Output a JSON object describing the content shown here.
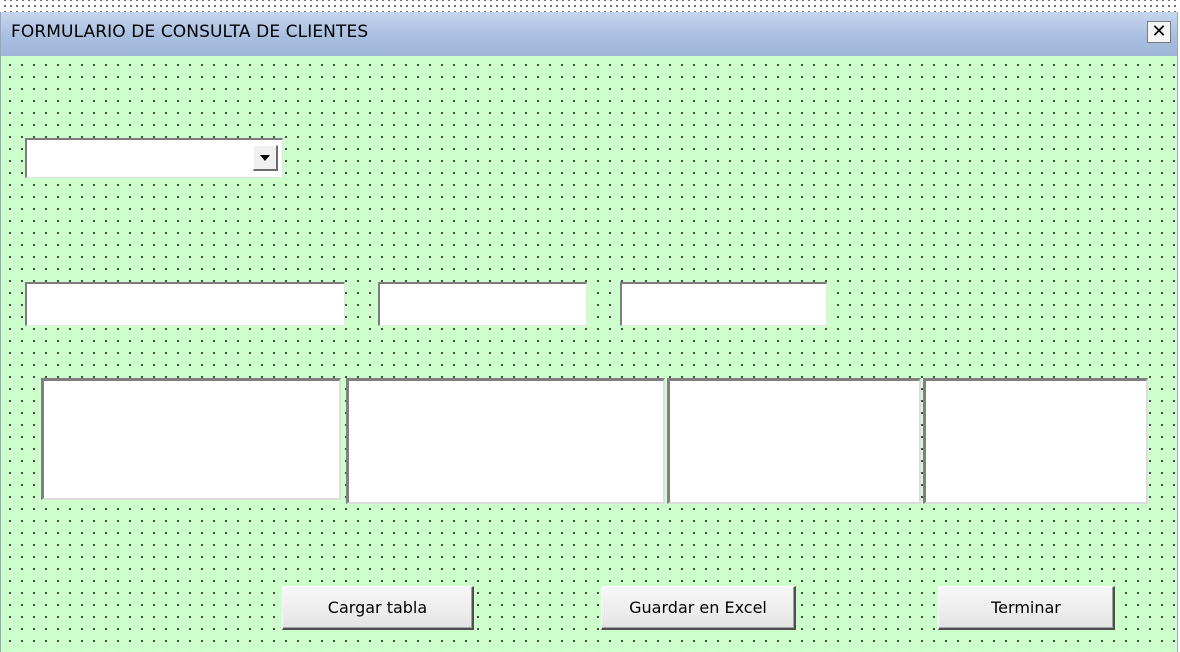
{
  "window": {
    "title": "FORMULARIO DE CONSULTA DE CLIENTES",
    "close_label": "✕"
  },
  "colors": {
    "background": "#ccffcc",
    "titlebar": "#a9bfe0"
  },
  "combo": {
    "value": ""
  },
  "textboxes": [
    "",
    "",
    ""
  ],
  "listboxes": [
    "",
    "",
    "",
    ""
  ],
  "buttons": {
    "load_table": "Cargar tabla",
    "save_excel": "Guardar en Excel",
    "finish": "Terminar"
  }
}
